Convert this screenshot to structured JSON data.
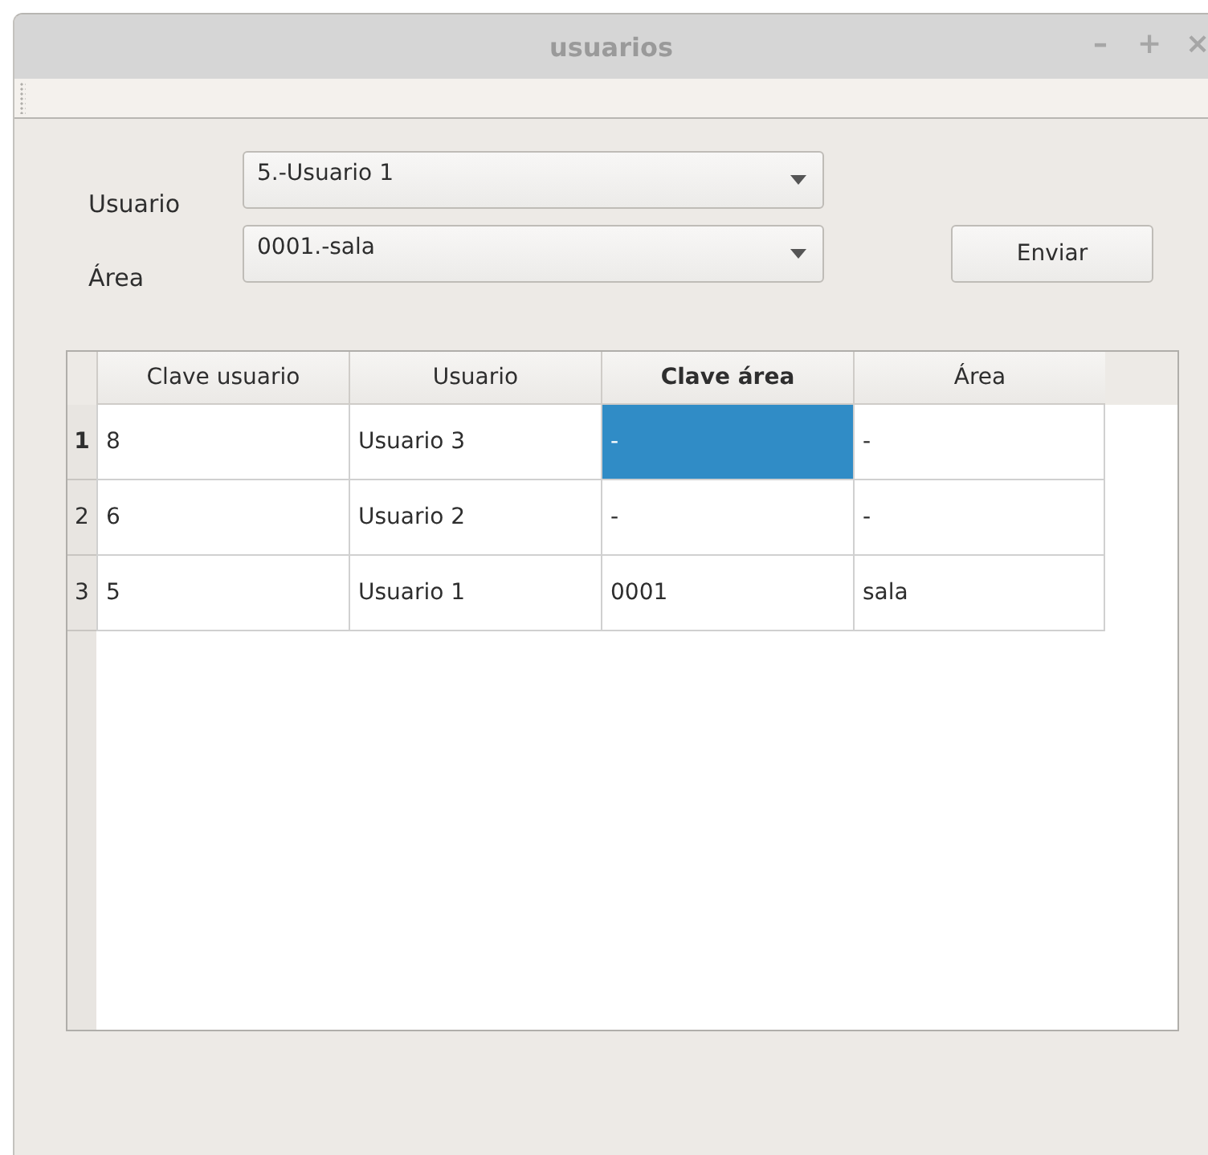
{
  "window": {
    "title": "usuarios",
    "controls": [
      "–",
      "+",
      "×"
    ]
  },
  "form": {
    "fields": [
      {
        "label": "Usuario",
        "value": "5.-Usuario 1"
      },
      {
        "label": "Área",
        "value": "0001.-sala"
      }
    ],
    "button": "Enviar"
  },
  "table": {
    "columns": [
      {
        "label": "Clave usuario",
        "selected": false
      },
      {
        "label": "Usuario",
        "selected": false
      },
      {
        "label": "Clave área",
        "selected": true
      },
      {
        "label": "Área",
        "selected": false
      }
    ],
    "rows": [
      {
        "number": "1",
        "selected": true,
        "cells": [
          {
            "text": "8",
            "selected": false
          },
          {
            "text": "Usuario 3",
            "selected": false
          },
          {
            "text": "-",
            "selected": true
          },
          {
            "text": "-",
            "selected": false
          }
        ]
      },
      {
        "number": "2",
        "selected": false,
        "cells": [
          {
            "text": "6",
            "selected": false
          },
          {
            "text": "Usuario 2",
            "selected": false
          },
          {
            "text": "-",
            "selected": false
          },
          {
            "text": "-",
            "selected": false
          }
        ]
      },
      {
        "number": "3",
        "selected": false,
        "cells": [
          {
            "text": "5",
            "selected": false
          },
          {
            "text": "Usuario 1",
            "selected": false
          },
          {
            "text": "0001",
            "selected": false
          },
          {
            "text": "sala",
            "selected": false
          }
        ]
      }
    ]
  }
}
